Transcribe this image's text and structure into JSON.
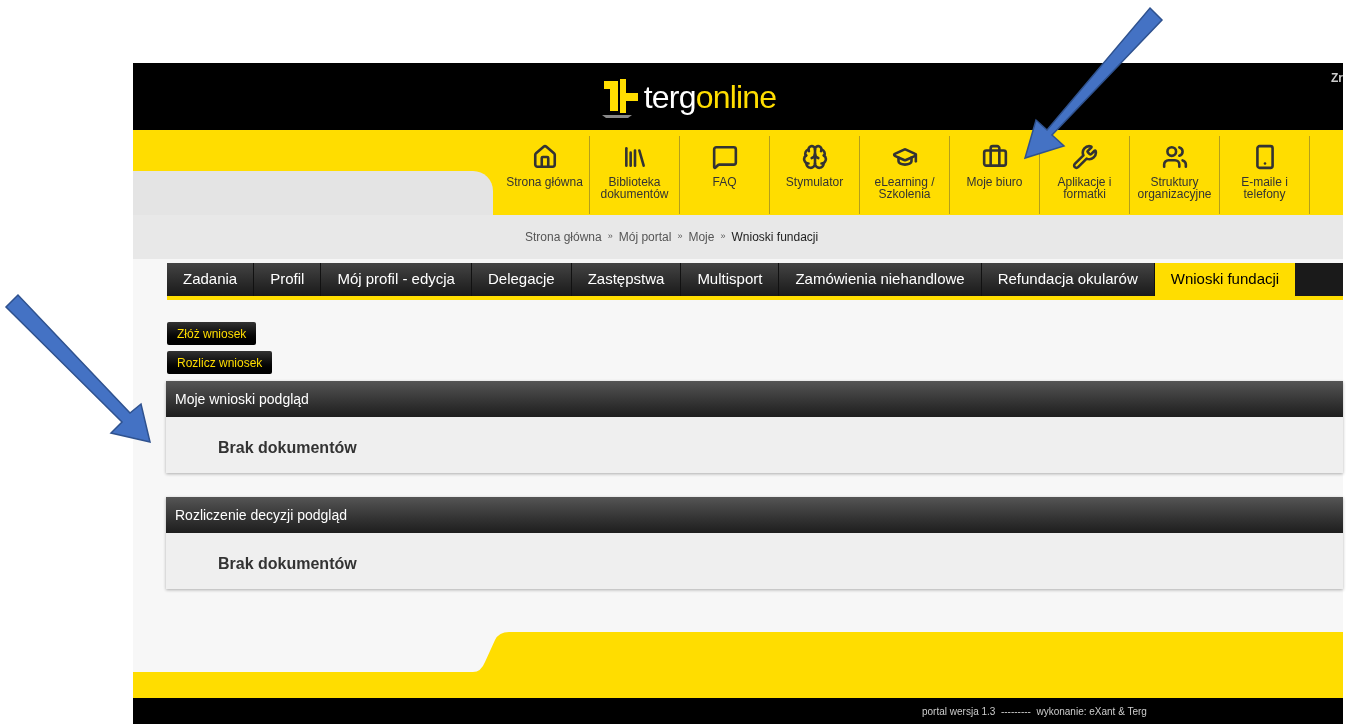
{
  "header": {
    "logo": {
      "part1": "terg",
      "part2": "online"
    },
    "corner_text": "Zr"
  },
  "nav": [
    {
      "label": "Strona główna"
    },
    {
      "label": "Biblioteka dokumentów"
    },
    {
      "label": "FAQ"
    },
    {
      "label": "Stymulator"
    },
    {
      "label": "eLearning / Szkolenia"
    },
    {
      "label": "Moje biuro"
    },
    {
      "label": "Aplikacje i formatki"
    },
    {
      "label": "Struktury organizacyjne"
    },
    {
      "label": "E-maile i telefony"
    }
  ],
  "breadcrumb": {
    "separator": "»",
    "items": [
      "Strona główna",
      "Mój portal",
      "Moje",
      "Wnioski fundacji"
    ]
  },
  "tabs": [
    {
      "label": "Zadania",
      "selected": false
    },
    {
      "label": "Profil",
      "selected": false
    },
    {
      "label": "Mój profil - edycja",
      "selected": false
    },
    {
      "label": "Delegacje",
      "selected": false
    },
    {
      "label": "Zastępstwa",
      "selected": false
    },
    {
      "label": "Multisport",
      "selected": false
    },
    {
      "label": "Zamówienia niehandlowe",
      "selected": false
    },
    {
      "label": "Refundacja okularów",
      "selected": false
    },
    {
      "label": "Wnioski fundacji",
      "selected": true
    }
  ],
  "actions": [
    "Złóż wniosek",
    "Rozlicz wniosek"
  ],
  "panels": [
    {
      "title": "Moje wnioski podgląd",
      "message": "Brak dokumentów"
    },
    {
      "title": "Rozliczenie decyzji podgląd",
      "message": "Brak dokumentów"
    }
  ],
  "footer": "portal wersja 1.3  ---------  wykonanie: eXant & Terg"
}
